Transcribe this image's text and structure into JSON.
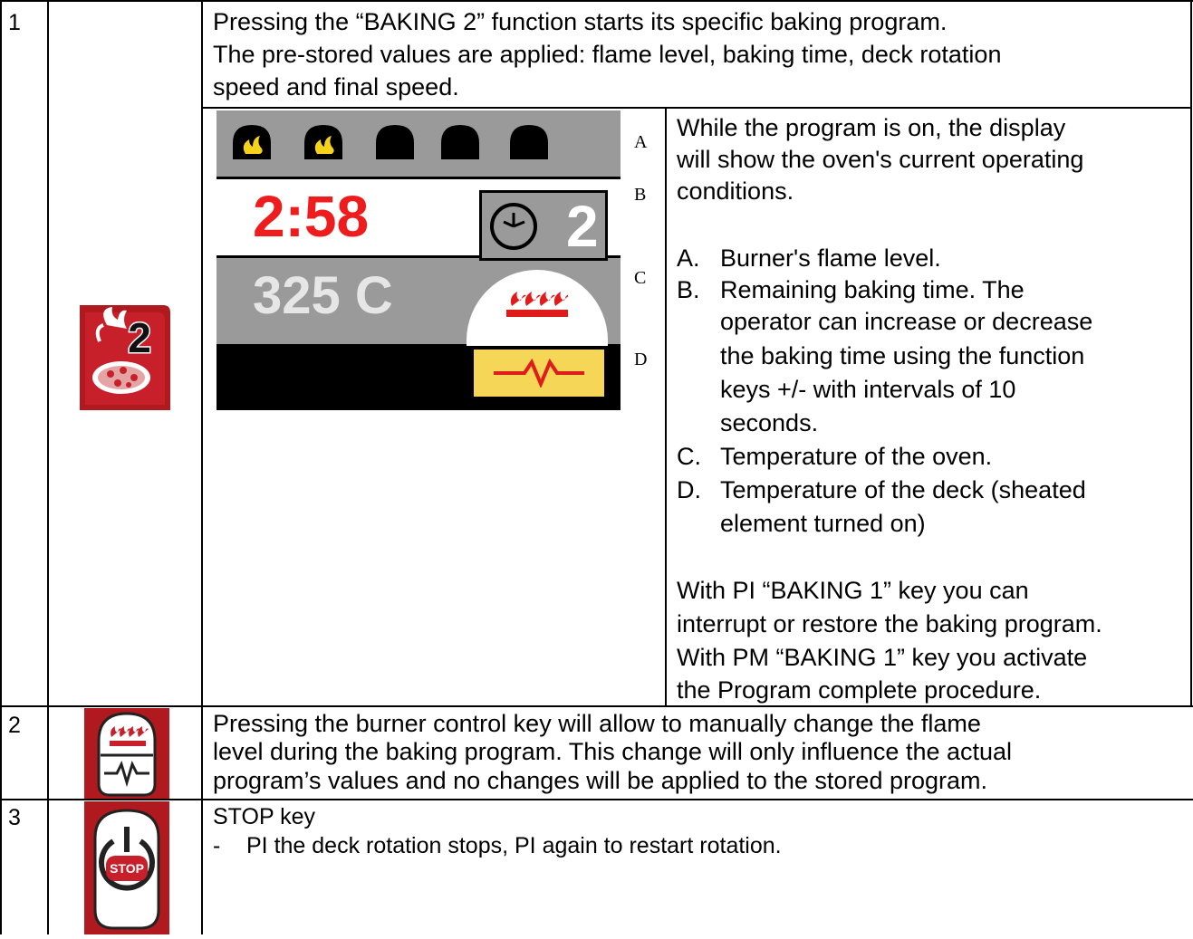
{
  "rows": [
    {
      "number": "1",
      "intro_lines": [
        "Pressing the “BAKING 2” function starts its specific baking program.",
        "The pre-stored values are applied: flame level, baking time, deck rotation",
        "speed and final speed."
      ],
      "key_icon": "baking-2-key-icon",
      "display": {
        "flame_states": [
          "on",
          "on",
          "off",
          "off",
          "off"
        ],
        "time": "2:58",
        "program_number": "2",
        "temperature": "325 C",
        "colors": {
          "time": "#ee1c1c",
          "panel_gray": "#9a9a9a",
          "deck_yellow": "#f5d656"
        }
      },
      "markers": [
        "A",
        "B",
        "C",
        "D"
      ],
      "desc_lines": [
        "While the program is on, the display",
        "will show the oven's current operating",
        "conditions."
      ],
      "list": [
        {
          "marker": "A.",
          "lines": [
            "Burner's flame level."
          ]
        },
        {
          "marker": "B.",
          "lines": [
            "Remaining baking time. The",
            "operator can increase or decrease",
            "the baking time using the function",
            "keys +/- with intervals of 10",
            "seconds."
          ]
        },
        {
          "marker": "C.",
          "lines": [
            "Temperature of the oven."
          ]
        },
        {
          "marker": "D.",
          "lines": [
            "Temperature of the deck (sheated",
            "element turned on)"
          ]
        }
      ],
      "footer_lines": [
        "With PI “BAKING 1” key you can",
        "interrupt or restore the baking program.",
        "With PM “BAKING 1” key you activate",
        "the Program complete procedure."
      ]
    },
    {
      "number": "2",
      "key_icon": "burner-control-key-icon",
      "lines": [
        "Pressing the burner control key will allow to manually change the flame",
        "level during the baking program. This change will only influence the actual",
        "program’s values and no changes will be applied to the stored program."
      ]
    },
    {
      "number": "3",
      "key_icon": "stop-key-icon",
      "title": "STOP key",
      "bullet_dash": "-",
      "bullet": "PI  the deck rotation stops, PI again to restart rotation.",
      "key_label": "STOP"
    }
  ]
}
